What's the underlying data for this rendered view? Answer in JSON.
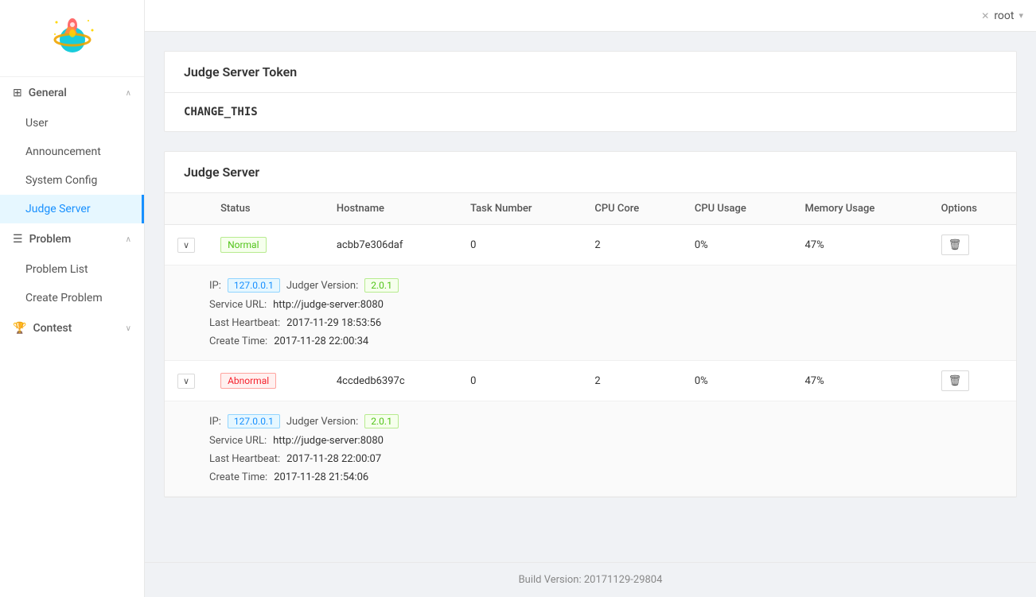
{
  "topbar": {
    "user": "root",
    "close_icon": "✕",
    "dropdown_icon": "▾"
  },
  "sidebar": {
    "logo_alt": "OJ Logo",
    "groups": [
      {
        "id": "general",
        "label": "General",
        "icon": "⊞",
        "expanded": true,
        "items": [
          {
            "id": "user",
            "label": "User",
            "active": false
          },
          {
            "id": "announcement",
            "label": "Announcement",
            "active": false
          },
          {
            "id": "system-config",
            "label": "System Config",
            "active": false
          },
          {
            "id": "judge-server",
            "label": "Judge Server",
            "active": true
          }
        ]
      },
      {
        "id": "problem",
        "label": "Problem",
        "icon": "☰",
        "expanded": true,
        "items": [
          {
            "id": "problem-list",
            "label": "Problem List",
            "active": false
          },
          {
            "id": "create-problem",
            "label": "Create Problem",
            "active": false
          }
        ]
      },
      {
        "id": "contest",
        "label": "Contest",
        "icon": "🏆",
        "expanded": false,
        "items": []
      }
    ]
  },
  "token_card": {
    "title": "Judge Server Token",
    "value": "CHANGE_THIS"
  },
  "judge_server_card": {
    "title": "Judge Server",
    "table": {
      "columns": [
        "Status",
        "Hostname",
        "Task Number",
        "CPU Core",
        "CPU Usage",
        "Memory Usage",
        "Options"
      ],
      "rows": [
        {
          "id": "row1",
          "status": "Normal",
          "status_type": "normal",
          "hostname": "acbb7e306daf",
          "task_number": "0",
          "cpu_core": "2",
          "cpu_usage": "0%",
          "memory_usage": "47%",
          "expanded": true,
          "details": {
            "ip_label": "IP:",
            "ip": "127.0.0.1",
            "judger_version_label": "Judger Version:",
            "judger_version": "2.0.1",
            "service_url_label": "Service URL:",
            "service_url": "http://judge-server:8080",
            "last_heartbeat_label": "Last Heartbeat:",
            "last_heartbeat": "2017-11-29 18:53:56",
            "create_time_label": "Create Time:",
            "create_time": "2017-11-28 22:00:34"
          }
        },
        {
          "id": "row2",
          "status": "Abnormal",
          "status_type": "abnormal",
          "hostname": "4ccdedb6397c",
          "task_number": "0",
          "cpu_core": "2",
          "cpu_usage": "0%",
          "memory_usage": "47%",
          "expanded": true,
          "details": {
            "ip_label": "IP:",
            "ip": "127.0.0.1",
            "judger_version_label": "Judger Version:",
            "judger_version": "2.0.1",
            "service_url_label": "Service URL:",
            "service_url": "http://judge-server:8080",
            "last_heartbeat_label": "Last Heartbeat:",
            "last_heartbeat": "2017-11-28 22:00:07",
            "create_time_label": "Create Time:",
            "create_time": "2017-11-28 21:54:06"
          }
        }
      ]
    }
  },
  "footer": {
    "text": "Build Version: 20171129-29804"
  }
}
